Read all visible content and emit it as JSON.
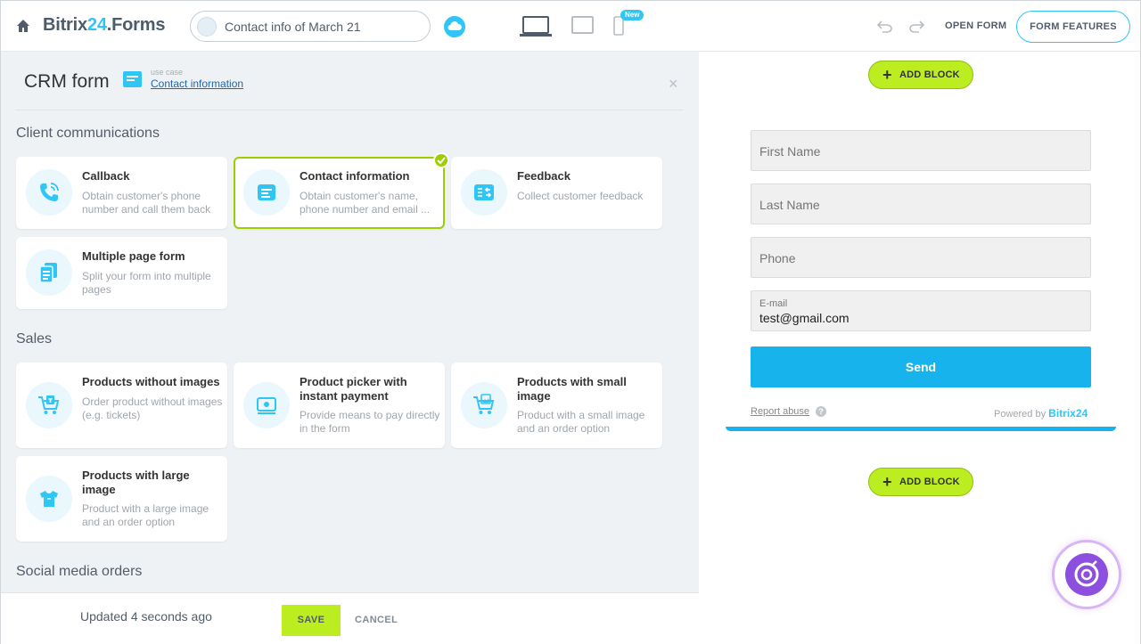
{
  "header": {
    "brand_main": "Bitrix",
    "brand_accent": "24",
    "brand_suffix": ".Forms",
    "form_name": "Contact info of March 21",
    "new_badge": "New",
    "open_form": "OPEN FORM",
    "form_features": "FORM FEATURES"
  },
  "panel": {
    "title": "CRM form",
    "usecase_label": "use case",
    "usecase_value": "Contact information",
    "close": "×"
  },
  "sections": {
    "client_communications": {
      "title": "Client communications",
      "cards": [
        {
          "title": "Callback",
          "desc": "Obtain customer's phone number and call them back"
        },
        {
          "title": "Contact information",
          "desc": "Obtain customer's name, phone number and email ..."
        },
        {
          "title": "Feedback",
          "desc": "Collect customer feedback"
        },
        {
          "title": "Multiple page form",
          "desc": "Split your form into multiple pages"
        }
      ]
    },
    "sales": {
      "title": "Sales",
      "cards": [
        {
          "title": "Products without images",
          "desc": "Order product without images (e.g. tickets)"
        },
        {
          "title": "Product picker with instant payment",
          "desc": "Provide means to pay directly in the form"
        },
        {
          "title": "Products with small image",
          "desc": "Product with a small image and an order option"
        },
        {
          "title": "Products with large image",
          "desc": "Product with a large image and an order option"
        }
      ]
    },
    "social": {
      "title": "Social media orders"
    }
  },
  "bottom": {
    "updated": "Updated 4 seconds ago",
    "save": "SAVE",
    "cancel": "CANCEL"
  },
  "preview": {
    "add_block": "ADD BLOCK",
    "plus": "+",
    "fields": {
      "first_name": "First Name",
      "last_name": "Last Name",
      "phone": "Phone",
      "email_label": "E-mail",
      "email_value": "test@gmail.com"
    },
    "send": "Send",
    "report_abuse": "Report abuse",
    "help": "?",
    "powered_by": "Powered by",
    "powered_brand": "Bitrix24"
  },
  "colors": {
    "accent": "#2fc6f6",
    "lime": "#bbed21",
    "send": "#17b3ed",
    "selected_border": "#9dcf00"
  }
}
